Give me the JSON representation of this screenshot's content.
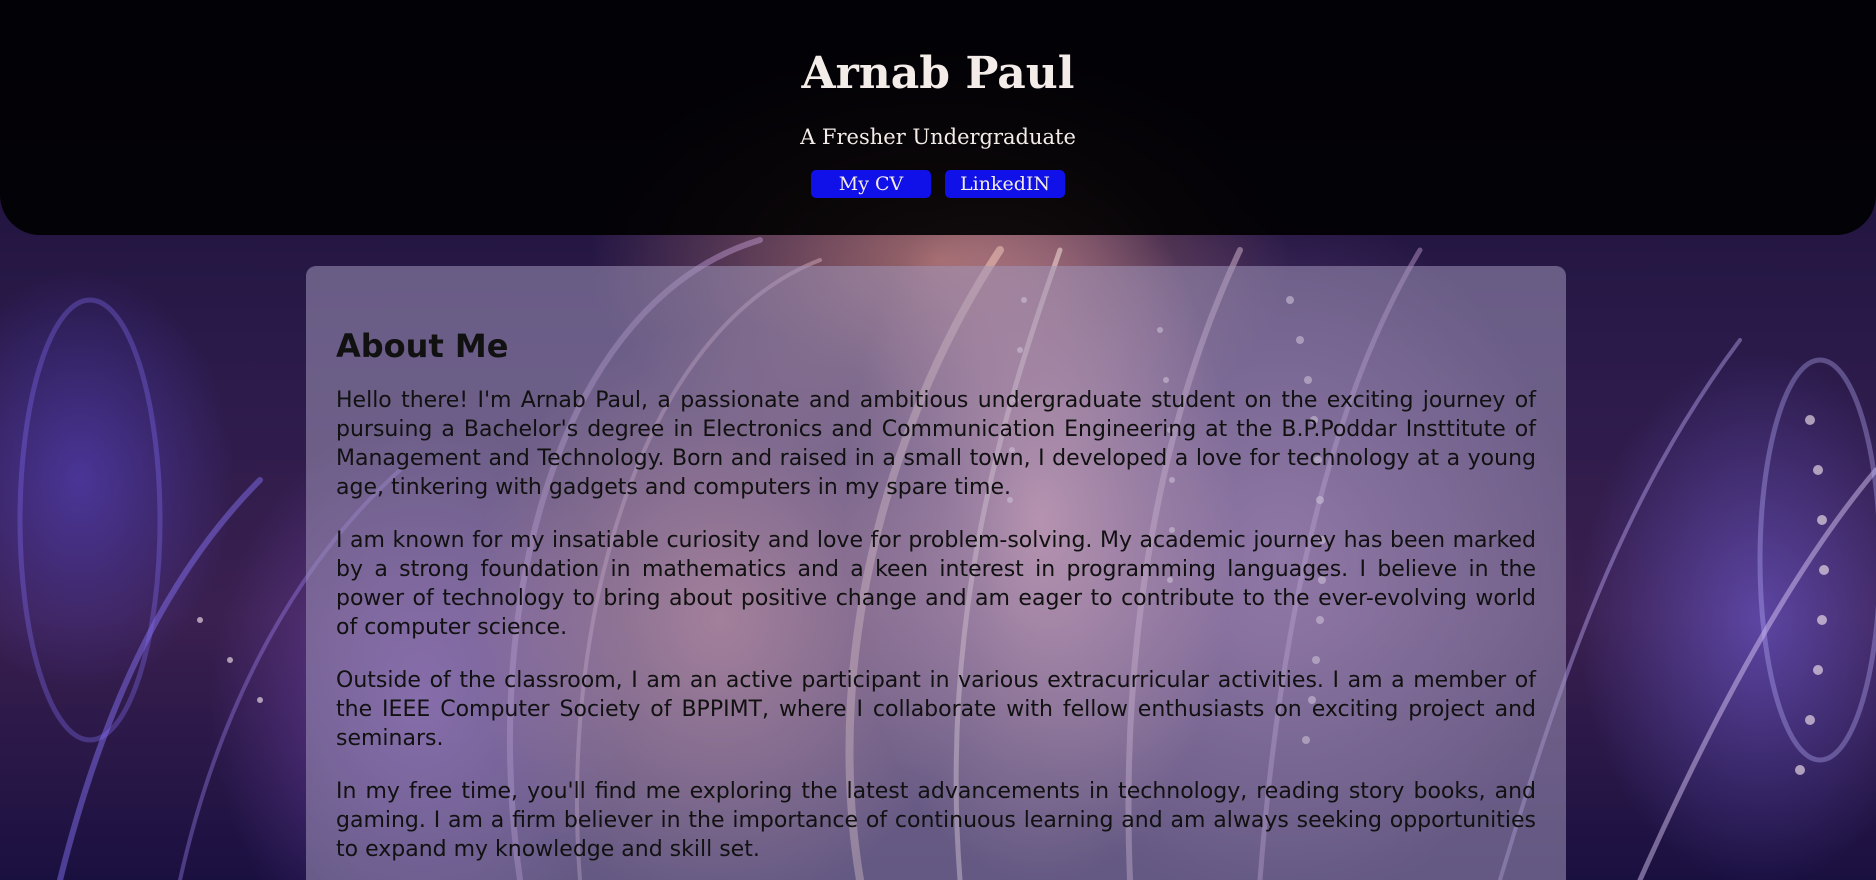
{
  "header": {
    "name": "Arnab Paul",
    "tagline": "A Fresher Undergraduate",
    "nav": [
      {
        "label": "My CV"
      },
      {
        "label": "LinkedIN"
      }
    ]
  },
  "about": {
    "heading": "About Me",
    "paragraphs": [
      "Hello there! I'm Arnab Paul, a passionate and ambitious undergraduate student on the exciting journey of pursuing a Bachelor's degree in Electronics and Communication Engineering at the B.P.Poddar Insttitute of Management and Technology. Born and raised in a small town, I developed a love for technology at a young age, tinkering with gadgets and computers in my spare time.",
      "I am known for my insatiable curiosity and love for problem-solving. My academic journey has been marked by a strong foundation in mathematics and a keen interest in programming languages. I believe in the power of technology to bring about positive change and am eager to contribute to the ever-evolving world of computer science.",
      "Outside of the classroom, I am an active participant in various extracurricular activities. I am a member of the IEEE Computer Society of BPPIMT, where I collaborate with fellow enthusiasts on exciting project and seminars.",
      "In my free time, you'll find me exploring the latest advancements in technology, reading story books, and gaming. I am a firm believer in the importance of continuous learning and am always seeking opportunities to expand my knowledge and skill set."
    ]
  },
  "colors": {
    "header_bg": "#000000",
    "button_bg": "#1010e8",
    "text_light": "#f3ece8",
    "card_bg": "#a096b9"
  }
}
